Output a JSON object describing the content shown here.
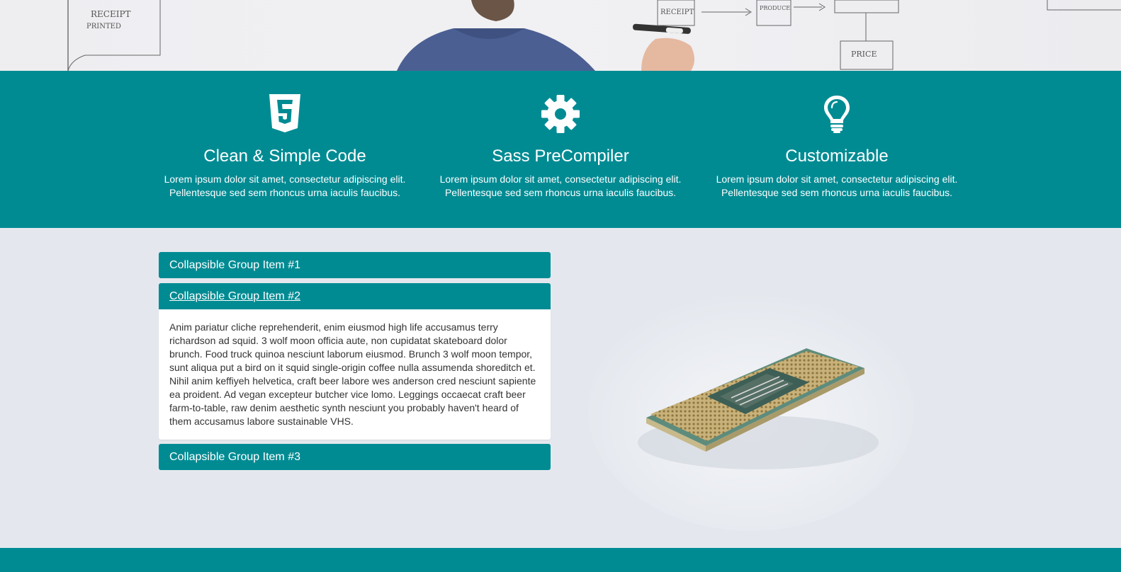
{
  "hero": {
    "whiteboard_notes": [
      "RECEIPT",
      "PRINTED",
      "RECEIPT",
      "PRICE",
      "PRODUCE"
    ]
  },
  "features": [
    {
      "icon": "html5-icon",
      "title": "Clean & Simple Code",
      "line1": "Lorem ipsum dolor sit amet, consectetur adipiscing elit.",
      "line2": "Pellentesque sed sem rhoncus urna iaculis faucibus."
    },
    {
      "icon": "gear-icon",
      "title": "Sass PreCompiler",
      "line1": "Lorem ipsum dolor sit amet, consectetur adipiscing elit.",
      "line2": "Pellentesque sed sem rhoncus urna iaculis faucibus."
    },
    {
      "icon": "lightbulb-icon",
      "title": "Customizable",
      "line1": "Lorem ipsum dolor sit amet, consectetur adipiscing elit.",
      "line2": "Pellentesque sed sem rhoncus urna iaculis faucibus."
    }
  ],
  "accordion": {
    "items": [
      {
        "label": "Collapsible Group Item #1",
        "expanded": false
      },
      {
        "label": "Collapsible Group Item #2",
        "expanded": true
      },
      {
        "label": "Collapsible Group Item #3",
        "expanded": false
      }
    ],
    "body_text": "Anim pariatur cliche reprehenderit, enim eiusmod high life accusamus terry richardson ad squid. 3 wolf moon officia aute, non cupidatat skateboard dolor brunch. Food truck quinoa nesciunt laborum eiusmod. Brunch 3 wolf moon tempor, sunt aliqua put a bird on it squid single-origin coffee nulla assumenda shoreditch et. Nihil anim keffiyeh helvetica, craft beer labore wes anderson cred nesciunt sapiente ea proident. Ad vegan excepteur butcher vice lomo. Leggings occaecat craft beer farm-to-table, raw denim aesthetic synth nesciunt you probably haven't heard of them accusamus labore sustainable VHS."
  },
  "colors": {
    "brand": "#008b93",
    "page_bg": "#e4e8ee",
    "text": "#333333"
  }
}
